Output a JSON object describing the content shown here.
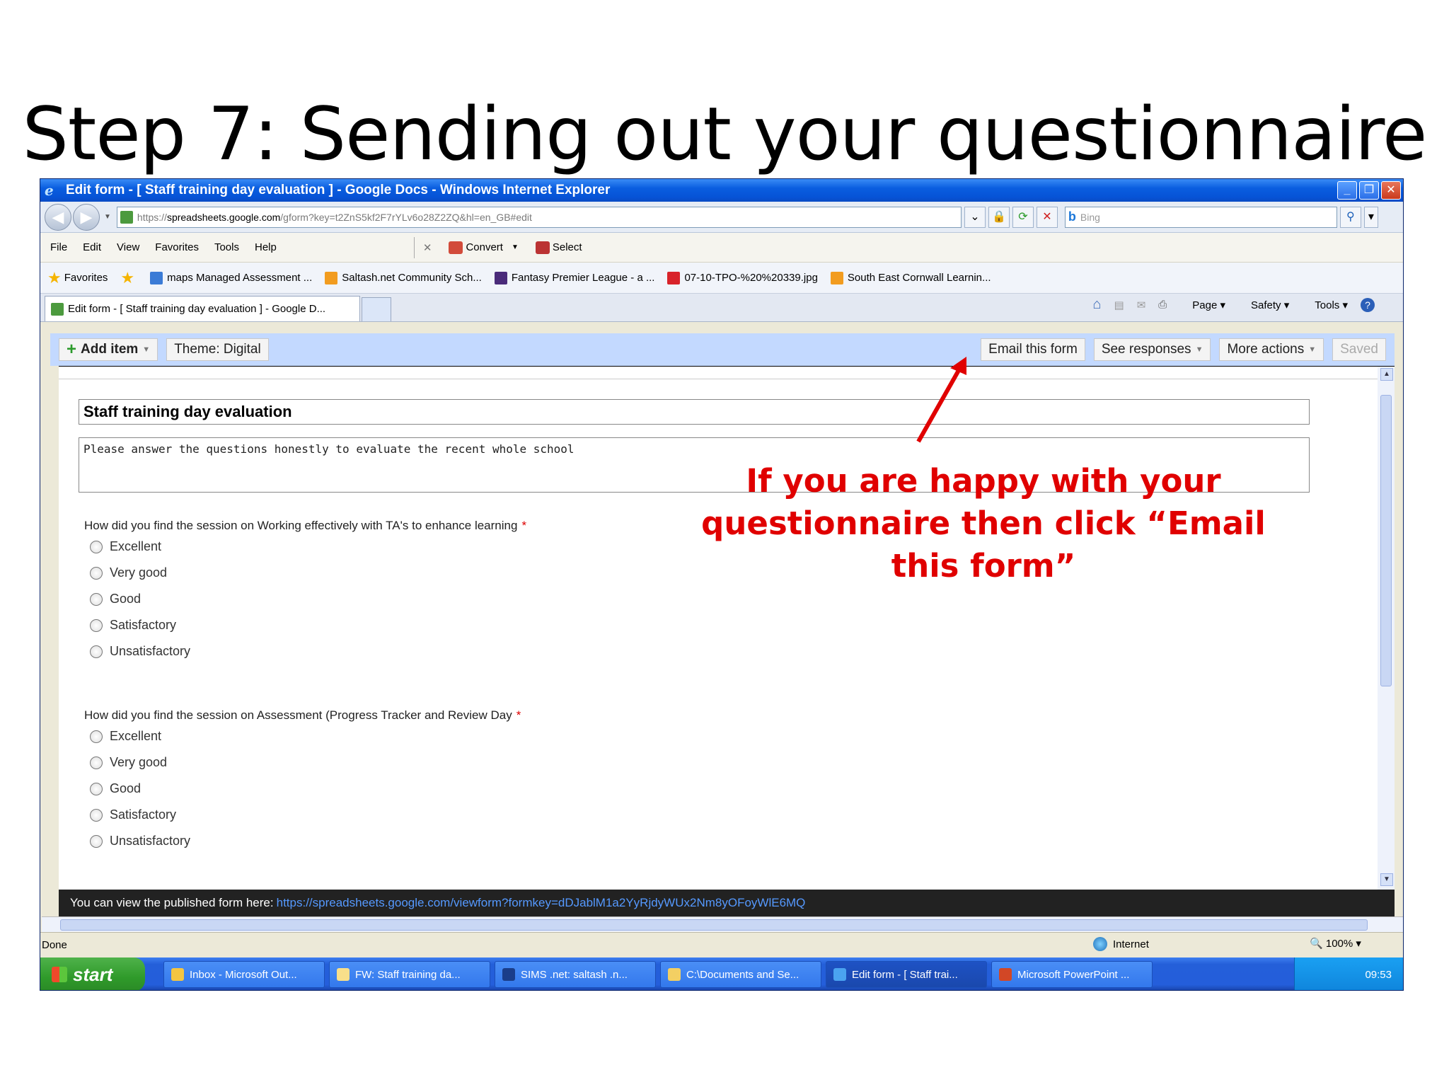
{
  "slide": {
    "title": "Step 7: Sending out your questionnaire"
  },
  "window": {
    "title": "Edit form - [ Staff training day evaluation ] - Google Docs - Windows Internet Explorer"
  },
  "address": {
    "prefix": "https://",
    "host": "spreadsheets.google.com",
    "path": "/gform?key=t2ZnS5kf2F7rYLv6o28Z2ZQ&hl=en_GB#edit"
  },
  "search": {
    "placeholder": "Bing"
  },
  "menu": {
    "file": "File",
    "edit": "Edit",
    "view": "View",
    "favorites": "Favorites",
    "tools": "Tools",
    "help": "Help",
    "convert": "Convert",
    "select": "Select"
  },
  "favbar": {
    "favorites": "Favorites",
    "items": [
      "maps Managed Assessment ...",
      "Saltash.net Community Sch...",
      "Fantasy Premier League - a ...",
      "07-10-TPO-%20%20339.jpg",
      "South East Cornwall Learnin..."
    ]
  },
  "tabbar": {
    "tab": "Edit form - [ Staff training day evaluation ] - Google D...",
    "page": "Page",
    "safety": "Safety",
    "tools": "Tools"
  },
  "gtoolbar": {
    "add_item": "Add item",
    "theme": "Theme:  Digital",
    "email": "Email this form",
    "responses": "See responses",
    "more": "More actions",
    "saved": "Saved"
  },
  "form": {
    "title": "Staff training day evaluation",
    "description": "Please answer the questions honestly to evaluate the recent whole school",
    "questions": [
      {
        "text": "How did you find the session on Working effectively with TA's to enhance learning",
        "options": [
          "Excellent",
          "Very good",
          "Good",
          "Satisfactory",
          "Unsatisfactory"
        ]
      },
      {
        "text": "How did you find the session on Assessment (Progress Tracker and Review Day",
        "options": [
          "Excellent",
          "Very good",
          "Good",
          "Satisfactory",
          "Unsatisfactory"
        ]
      }
    ],
    "required_mark": "*"
  },
  "published": {
    "label": "You can view the published form here:",
    "url": "https://spreadsheets.google.com/viewform?formkey=dDJablM1a2YyRjdyWUx2Nm8yOFoyWlE6MQ"
  },
  "status": {
    "left": "Done",
    "zone": "Internet",
    "zoom": "100%"
  },
  "taskbar": {
    "start": "start",
    "tasks": [
      "Inbox - Microsoft Out...",
      "FW: Staff training da...",
      "SIMS .net: saltash .n...",
      "C:\\Documents and Se...",
      "Edit form - [ Staff trai...",
      "Microsoft PowerPoint ..."
    ],
    "clock": "09:53"
  },
  "annotation": {
    "text": "If you are happy with your questionnaire then click “Email this form”",
    "color": "#e00000"
  }
}
